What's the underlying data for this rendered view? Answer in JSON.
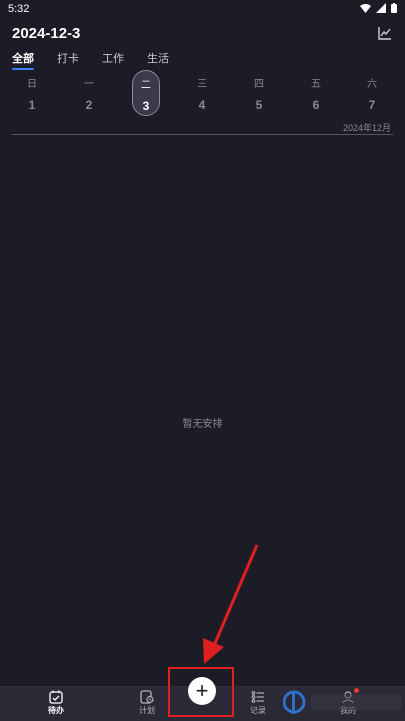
{
  "status_bar": {
    "time": "5:32"
  },
  "header": {
    "title": "2024-12-3"
  },
  "tabs": [
    {
      "label": "全部",
      "active": true
    },
    {
      "label": "打卡",
      "active": false
    },
    {
      "label": "工作",
      "active": false
    },
    {
      "label": "生活",
      "active": false
    }
  ],
  "week": [
    {
      "weekday": "日",
      "date": "1"
    },
    {
      "weekday": "一",
      "date": "2"
    },
    {
      "weekday": "二",
      "date": "3",
      "selected": true
    },
    {
      "weekday": "三",
      "date": "4"
    },
    {
      "weekday": "四",
      "date": "5"
    },
    {
      "weekday": "五",
      "date": "6"
    },
    {
      "weekday": "六",
      "date": "7"
    }
  ],
  "month_label": "2024年12月",
  "empty_state": "暂无安排",
  "bottom_nav": {
    "todo_label": "待办",
    "plan_label": "计划",
    "add_symbol": "+",
    "record_label": "记录",
    "mine_label": "我的"
  },
  "colors": {
    "background": "#1c1c26",
    "accent": "#3d7cf6",
    "annotation": "#e02020",
    "badge": "#e53935"
  }
}
